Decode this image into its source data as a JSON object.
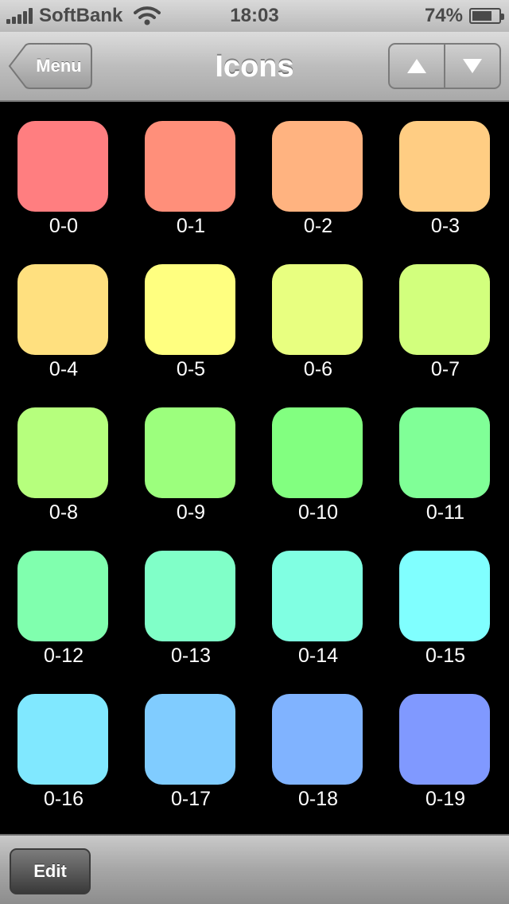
{
  "status_bar": {
    "carrier": "SoftBank",
    "time": "18:03",
    "battery_percent": "74%",
    "battery_level": 0.74
  },
  "nav_bar": {
    "title": "Icons",
    "back_label": "Menu",
    "up_icon": "triangle-up-icon",
    "down_icon": "triangle-down-icon"
  },
  "icons": [
    {
      "label": "0-0",
      "color": "#FF7E80"
    },
    {
      "label": "0-1",
      "color": "#FF8F7A"
    },
    {
      "label": "0-2",
      "color": "#FFB380"
    },
    {
      "label": "0-3",
      "color": "#FFCD83"
    },
    {
      "label": "0-4",
      "color": "#FFE07F"
    },
    {
      "label": "0-5",
      "color": "#FFFF80"
    },
    {
      "label": "0-6",
      "color": "#E8FF80"
    },
    {
      "label": "0-7",
      "color": "#D2FF7D"
    },
    {
      "label": "0-8",
      "color": "#B6FF7D"
    },
    {
      "label": "0-9",
      "color": "#9CFF7D"
    },
    {
      "label": "0-10",
      "color": "#82FF80"
    },
    {
      "label": "0-11",
      "color": "#80FF97"
    },
    {
      "label": "0-12",
      "color": "#80FFAE"
    },
    {
      "label": "0-13",
      "color": "#80FFC8"
    },
    {
      "label": "0-14",
      "color": "#80FFE2"
    },
    {
      "label": "0-15",
      "color": "#80FFFF"
    },
    {
      "label": "0-16",
      "color": "#80E8FF"
    },
    {
      "label": "0-17",
      "color": "#80CCFF"
    },
    {
      "label": "0-18",
      "color": "#80B3FF"
    },
    {
      "label": "0-19",
      "color": "#8099FF"
    }
  ],
  "toolbar": {
    "edit_label": "Edit"
  }
}
